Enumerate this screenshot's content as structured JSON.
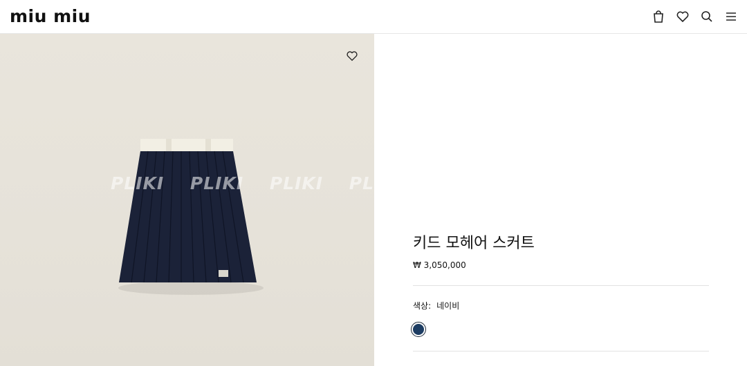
{
  "header": {
    "logo": "miu miu",
    "icons": [
      "bag-icon",
      "heart-icon",
      "search-icon",
      "menu-icon"
    ]
  },
  "gallery": {
    "watermark": "PLIKI PLIKI PLIKI PLIKI PL",
    "wishlist_icon": "heart-outline-icon",
    "colors": {
      "background": "#e8e4db",
      "skirt": "#1b2238",
      "waistband": "#f1eee2"
    }
  },
  "product": {
    "title": "키드 모헤어 스커트",
    "price": "₩ 3,050,000",
    "color_label": "색상:",
    "color_value": "네이비",
    "swatch_color": "#1d3d63"
  }
}
